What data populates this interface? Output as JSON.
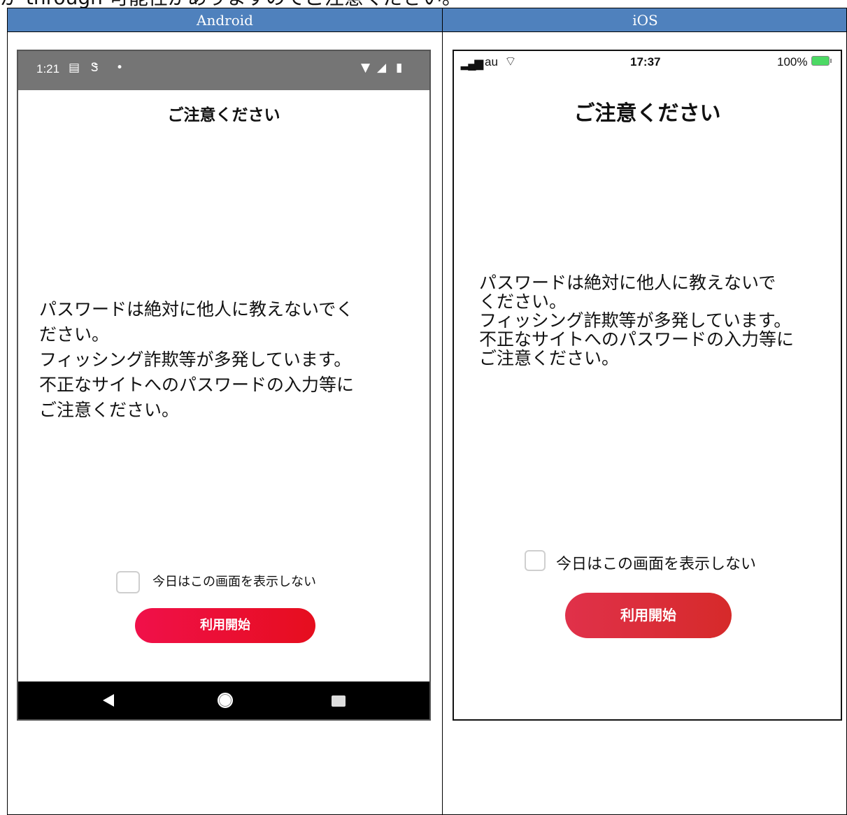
{
  "page_heading_fragment": "が through 可能性がありますのでご注意ください。",
  "table": {
    "headers": [
      "Android",
      "iOS"
    ]
  },
  "android": {
    "status": {
      "time": "1:21"
    },
    "title": "ご注意ください",
    "message_lines": [
      "パスワードは絶対に他人に教えないでく",
      "ださい。",
      "フィッシング詐欺等が多発しています。",
      "不正なサイトへのパスワードの入力等に",
      "ご注意ください。"
    ],
    "checkbox_label": "今日はこの画面を表示しない",
    "checkbox_checked": false,
    "start_button": "利用開始"
  },
  "ios": {
    "status": {
      "carrier": "au",
      "time": "17:37",
      "battery": "100%"
    },
    "title": "ご注意ください",
    "message_lines": [
      "パスワードは絶対に他人に教えないで",
      "ください。",
      "フィッシング詐欺等が多発しています。",
      "不正なサイトへのパスワードの入力等に",
      "ご注意ください。"
    ],
    "checkbox_label": "今日はこの画面を表示しない",
    "checkbox_checked": false,
    "start_button": "利用開始"
  },
  "colors": {
    "header_bg": "#4f81bd",
    "android_status_bg": "#757575",
    "button_red": "#e60e1e"
  }
}
